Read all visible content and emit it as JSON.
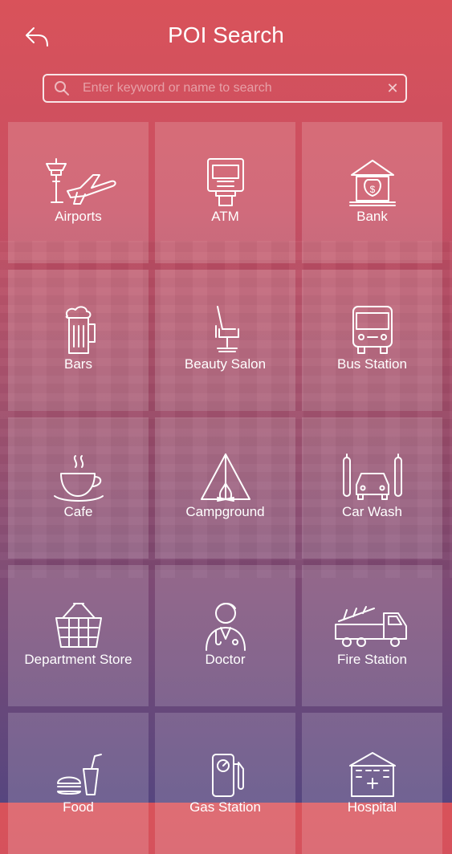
{
  "header": {
    "title": "POI Search"
  },
  "search": {
    "placeholder": "Enter keyword or name to search",
    "value": "",
    "clear_symbol": "✕"
  },
  "tiles": [
    {
      "label": "Airports",
      "icon": "airport-icon"
    },
    {
      "label": "ATM",
      "icon": "atm-icon"
    },
    {
      "label": "Bank",
      "icon": "bank-icon"
    },
    {
      "label": "Bars",
      "icon": "beer-icon"
    },
    {
      "label": "Beauty Salon",
      "icon": "salon-chair-icon"
    },
    {
      "label": "Bus Station",
      "icon": "bus-icon"
    },
    {
      "label": "Cafe",
      "icon": "coffee-cup-icon"
    },
    {
      "label": "Campground",
      "icon": "tent-icon"
    },
    {
      "label": "Car Wash",
      "icon": "car-wash-icon"
    },
    {
      "label": "Department Store",
      "icon": "basket-icon"
    },
    {
      "label": "Doctor",
      "icon": "doctor-icon"
    },
    {
      "label": "Fire Station",
      "icon": "fire-truck-icon"
    },
    {
      "label": "Food",
      "icon": "fast-food-icon"
    },
    {
      "label": "Gas Station",
      "icon": "fuel-pump-icon"
    },
    {
      "label": "Hospital",
      "icon": "hospital-icon"
    }
  ]
}
